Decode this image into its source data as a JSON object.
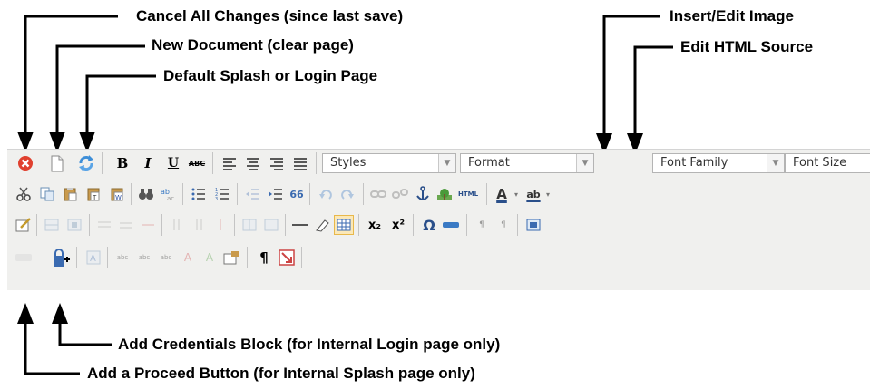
{
  "callouts": {
    "cancel": "Cancel All Changes (since last save)",
    "new_doc": "New Document (clear page)",
    "splash": "Default Splash or Login Page",
    "insert_image": "Insert/Edit Image",
    "edit_html": "Edit HTML Source",
    "credentials": "Add Credentials Block (for Internal Login page only)",
    "proceed": "Add a Proceed Button (for Internal Splash page only)"
  },
  "toolbar": {
    "styles_label": "Styles",
    "format_label": "Format",
    "font_family_label": "Font Family",
    "font_size_label": "Font Size",
    "bold": "B",
    "italic": "I",
    "underline": "U",
    "strike": "ABC",
    "html": "HTML",
    "text_color": "A",
    "highlight": "ab",
    "subscript": "x₂",
    "superscript": "x²",
    "omega": "Ω",
    "pilcrow": "¶",
    "quote": "66"
  }
}
